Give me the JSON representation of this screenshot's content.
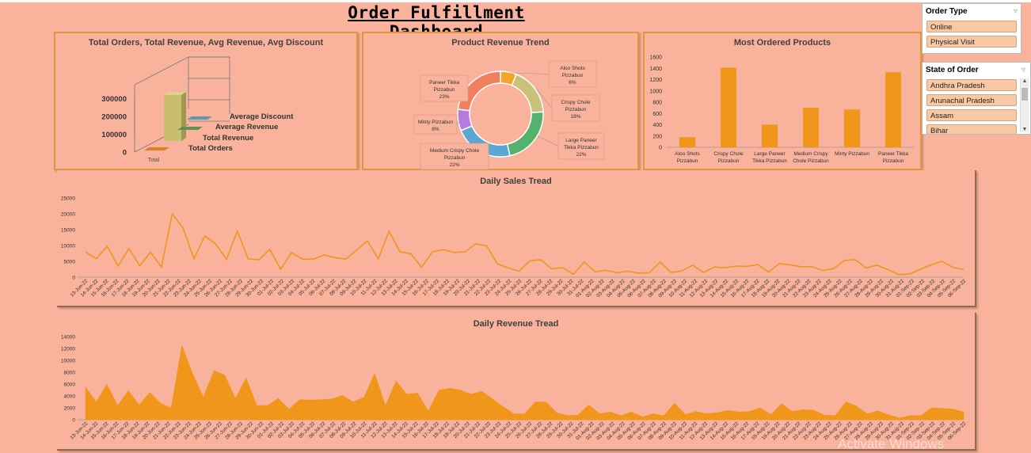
{
  "dashboard": {
    "title": "Order Fulfillment Dashboard",
    "watermark": "Activate Windows"
  },
  "slicers": {
    "order_type": {
      "title": "Order Type",
      "items": [
        "Online",
        "Physical Visit"
      ]
    },
    "state": {
      "title": "State of Order",
      "items": [
        "Andhra Pradesh",
        "Arunachal Pradesh",
        "Assam",
        "Bihar"
      ]
    }
  },
  "chart_data": [
    {
      "id": "kpi3d",
      "type": "bar",
      "title": "Total Orders, Total Revenue, Avg Revenue, Avg Discount",
      "categories": [
        "Total"
      ],
      "series": [
        {
          "name": "Total Orders",
          "values": [
            1000
          ],
          "color": "#D9822B"
        },
        {
          "name": "Total Revenue",
          "values": [
            265000
          ],
          "color": "#C8BE6E"
        },
        {
          "name": "Average Revenue",
          "values": [
            270
          ],
          "color": "#5F8F57"
        },
        {
          "name": "Average Discount",
          "values": [
            15
          ],
          "color": "#5B9BB2"
        }
      ],
      "yticks": [
        "300000",
        "200000",
        "100000",
        "0"
      ],
      "ylim": [
        0,
        300000
      ]
    },
    {
      "id": "donut",
      "type": "pie",
      "title": "Product Revenue Trend",
      "slices": [
        {
          "label": "Aloo Shots Pizzabun",
          "pct": "6%",
          "value": 6,
          "color": "#F3A72A"
        },
        {
          "label": "Crispy Chole Pizzabun",
          "pct": "18%",
          "value": 18,
          "color": "#C9C07A"
        },
        {
          "label": "Large Paneer Tikka Pizzabun",
          "pct": "22%",
          "value": 22,
          "color": "#52B26E"
        },
        {
          "label": "Medium Crispy Chole Pizzabun",
          "pct": "22%",
          "value": 22,
          "color": "#5AA8D2"
        },
        {
          "label": "Minty Pizzabun",
          "pct": "8%",
          "value": 8,
          "color": "#B77AE4"
        },
        {
          "label": "Paneer Tikka Pizzabun",
          "pct": "23%",
          "value": 23,
          "color": "#F37E5E"
        }
      ]
    },
    {
      "id": "bars",
      "type": "bar",
      "title": "Most Ordered Products",
      "categories": [
        [
          "Aloo Shots",
          "Pizzabun"
        ],
        [
          "Crispy Chole",
          "Pizzabun"
        ],
        [
          "Large Paneer",
          "Tikka Pizzabun"
        ],
        [
          "Medium Crispy",
          "Chole Pizzabun"
        ],
        [
          "Minty Pizzabun"
        ],
        [
          "Paneer Tikka",
          "Pizzabun"
        ]
      ],
      "values": [
        180,
        1410,
        400,
        700,
        670,
        1330
      ],
      "ylim": [
        0,
        1600
      ],
      "yticks": [
        0,
        200,
        400,
        600,
        800,
        1000,
        1200,
        1400,
        1600
      ],
      "color": "#F0961B"
    },
    {
      "id": "sales",
      "type": "line",
      "title": "Daily Sales Tread",
      "x": [
        "13-Jun-22",
        "14-Jun-22",
        "15-Jun-22",
        "16-Jun-22",
        "17-Jun-22",
        "18-Jun-22",
        "19-Jun-22",
        "20-Jun-22",
        "21-Jun-22",
        "22-Jun-22",
        "23-Jun-22",
        "24-Jun-22",
        "25-Jun-22",
        "26-Jun-22",
        "27-Jun-22",
        "28-Jun-22",
        "29-Jun-22",
        "30-Jun-22",
        "01-Jul-22",
        "02-Jul-22",
        "03-Jul-22",
        "04-Jul-22",
        "05-Jul-22",
        "06-Jul-22",
        "07-Jul-22",
        "08-Jul-22",
        "09-Jul-22",
        "10-Jul-22",
        "11-Jul-22",
        "12-Jul-22",
        "13-Jul-22",
        "14-Jul-22",
        "15-Jul-22",
        "16-Jul-22",
        "17-Jul-22",
        "18-Jul-22",
        "19-Jul-22",
        "20-Jul-22",
        "21-Jul-22",
        "22-Jul-22",
        "23-Jul-22",
        "24-Jul-22",
        "25-Jul-22",
        "26-Jul-22",
        "27-Jul-22",
        "28-Jul-22",
        "29-Jul-22",
        "30-Jul-22",
        "31-Jul-22",
        "01-Aug-22",
        "02-Aug-22",
        "03-Aug-22",
        "04-Aug-22",
        "05-Aug-22",
        "06-Aug-22",
        "07-Aug-22",
        "08-Aug-22",
        "09-Aug-22",
        "10-Aug-22",
        "11-Aug-22",
        "12-Aug-22",
        "13-Aug-22",
        "14-Aug-22",
        "15-Aug-22",
        "16-Aug-22",
        "17-Aug-22",
        "18-Aug-22",
        "19-Aug-22",
        "20-Aug-22",
        "21-Aug-22",
        "22-Aug-22",
        "23-Aug-22",
        "24-Aug-22",
        "25-Aug-22",
        "26-Aug-22",
        "27-Aug-22",
        "28-Aug-22",
        "29-Aug-22",
        "30-Aug-22",
        "31-Aug-22",
        "01-Sep-22",
        "02-Sep-22",
        "03-Sep-22",
        "04-Sep-22",
        "05-Sep-22",
        "06-Sep-22"
      ],
      "values": [
        8000,
        5800,
        9800,
        3500,
        9000,
        3600,
        7900,
        3200,
        20000,
        15500,
        5800,
        13000,
        10500,
        5600,
        14500,
        5800,
        5500,
        8800,
        2500,
        7800,
        5700,
        5700,
        7000,
        6200,
        5700,
        8500,
        11500,
        5800,
        14500,
        8000,
        7400,
        3100,
        8000,
        8700,
        7800,
        8000,
        10500,
        9900,
        4200,
        2900,
        1900,
        5200,
        5500,
        2600,
        3000,
        900,
        4800,
        1700,
        2200,
        1400,
        1900,
        1300,
        1400,
        4800,
        1500,
        2000,
        3800,
        1500,
        3200,
        3000,
        3500,
        3400,
        4000,
        1600,
        4300,
        3900,
        3300,
        3300,
        2100,
        2700,
        5300,
        5500,
        2900,
        3800,
        2400,
        800,
        1000,
        2500,
        3900,
        5000,
        3100,
        2400
      ],
      "ylim": [
        0,
        25000
      ],
      "yticks": [
        0,
        5000,
        10000,
        15000,
        20000,
        25000
      ],
      "color": "#F0961B"
    },
    {
      "id": "revenue",
      "type": "area",
      "title": "Daily Revenue Tread",
      "x": [
        "13-Jun-22",
        "14-Jun-22",
        "15-Jun-22",
        "16-Jun-22",
        "17-Jun-22",
        "18-Jun-22",
        "19-Jun-22",
        "20-Jun-22",
        "21-Jun-22",
        "22-Jun-22",
        "23-Jun-22",
        "24-Jun-22",
        "25-Jun-22",
        "26-Jun-22",
        "27-Jun-22",
        "28-Jun-22",
        "29-Jun-22",
        "30-Jun-22",
        "01-Jul-22",
        "02-Jul-22",
        "03-Jul-22",
        "04-Jul-22",
        "05-Jul-22",
        "06-Jul-22",
        "07-Jul-22",
        "08-Jul-22",
        "09-Jul-22",
        "10-Jul-22",
        "11-Jul-22",
        "12-Jul-22",
        "13-Jul-22",
        "14-Jul-22",
        "15-Jul-22",
        "16-Jul-22",
        "17-Jul-22",
        "18-Jul-22",
        "19-Jul-22",
        "20-Jul-22",
        "21-Jul-22",
        "22-Jul-22",
        "23-Jul-22",
        "24-Jul-22",
        "25-Jul-22",
        "26-Jul-22",
        "27-Jul-22",
        "28-Jul-22",
        "29-Jul-22",
        "30-Jul-22",
        "31-Jul-22",
        "01-Aug-22",
        "02-Aug-22",
        "03-Aug-22",
        "04-Aug-22",
        "05-Aug-22",
        "06-Aug-22",
        "07-Aug-22",
        "08-Aug-22",
        "09-Aug-22",
        "10-Aug-22",
        "11-Aug-22",
        "12-Aug-22",
        "13-Aug-22",
        "14-Aug-22",
        "15-Aug-22",
        "16-Aug-22",
        "17-Aug-22",
        "18-Aug-22",
        "19-Aug-22",
        "20-Aug-22",
        "21-Aug-22",
        "22-Aug-22",
        "23-Aug-22",
        "24-Aug-22",
        "25-Aug-22",
        "26-Aug-22",
        "27-Aug-22",
        "28-Aug-22",
        "29-Aug-22",
        "30-Aug-22",
        "31-Aug-22",
        "01-Sep-22",
        "02-Sep-22",
        "03-Sep-22",
        "04-Sep-22",
        "05-Sep-22",
        "06-Sep-22"
      ],
      "values": [
        5500,
        3000,
        6000,
        2400,
        4900,
        2500,
        4600,
        2800,
        2000,
        12500,
        7800,
        3800,
        8300,
        7500,
        3600,
        7000,
        2400,
        2400,
        3600,
        1800,
        3400,
        3300,
        3400,
        3500,
        4100,
        3000,
        3800,
        7800,
        2400,
        6500,
        4300,
        4500,
        1500,
        5000,
        5300,
        5000,
        4300,
        4800,
        3500,
        2200,
        1000,
        1000,
        3000,
        3000,
        1200,
        700,
        800,
        2500,
        1000,
        1300,
        700,
        1300,
        500,
        1000,
        700,
        2800,
        900,
        1400,
        1000,
        1200,
        1600,
        1300,
        1400,
        2000,
        900,
        2700,
        1400,
        1700,
        1600,
        800,
        700,
        3000,
        2300,
        1000,
        1500,
        800,
        300,
        700,
        700,
        2000,
        1900,
        1800,
        1300
      ],
      "ylim": [
        0,
        14000
      ],
      "yticks": [
        0,
        2000,
        4000,
        6000,
        8000,
        10000,
        12000,
        14000
      ],
      "color": "#F0961B"
    }
  ]
}
